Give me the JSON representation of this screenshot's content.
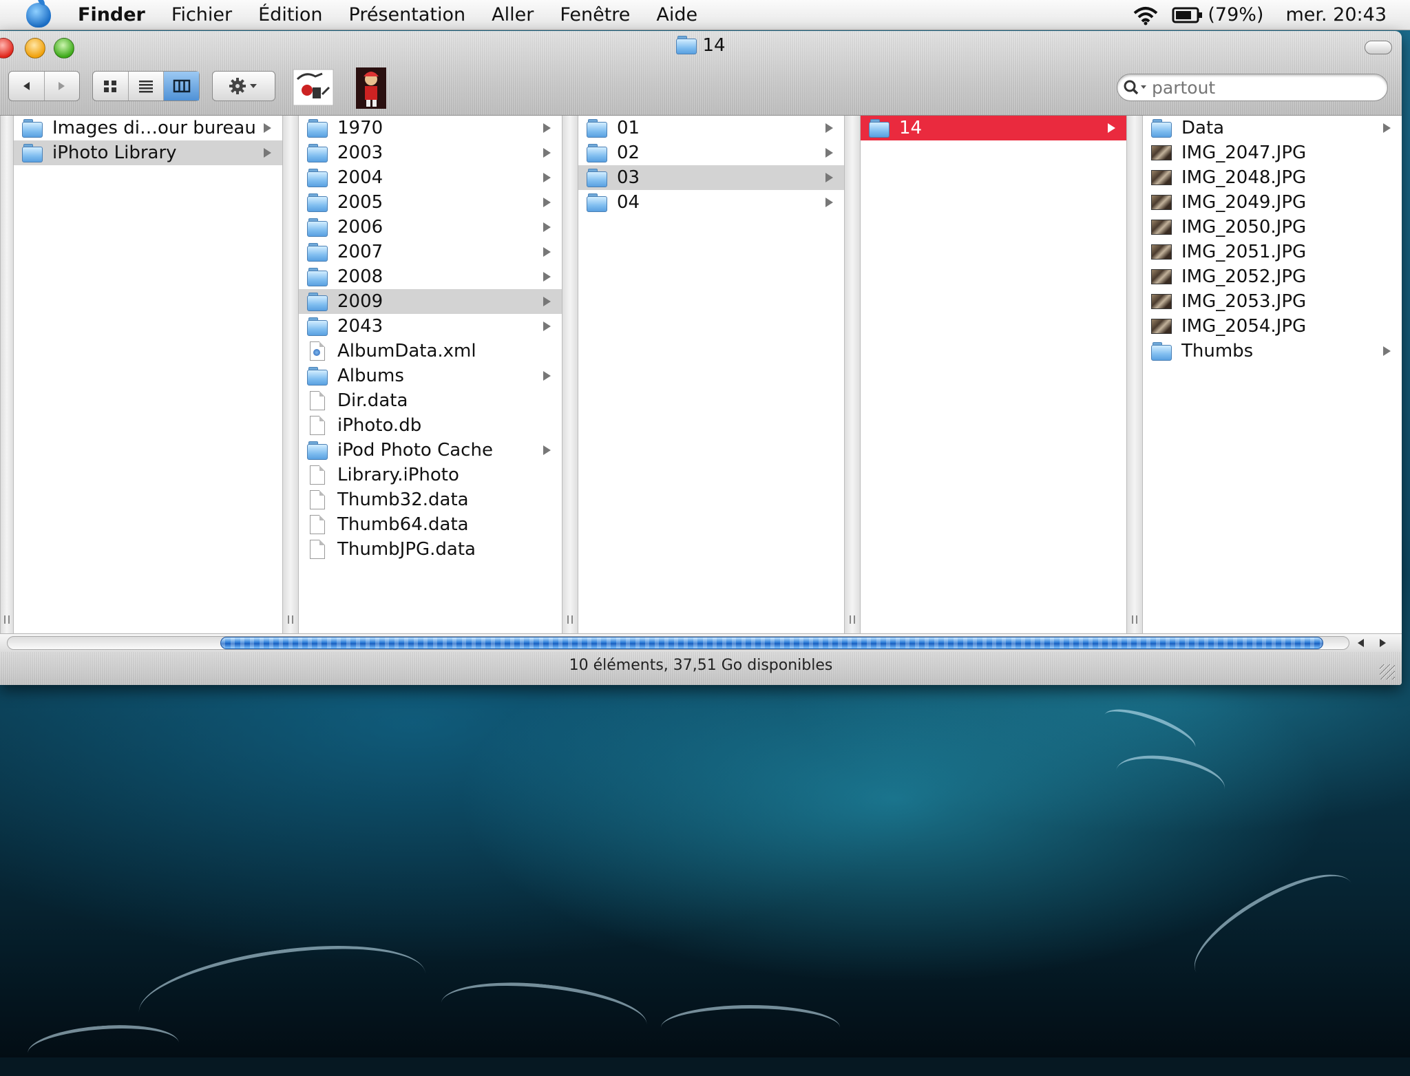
{
  "menubar": {
    "items": [
      "Finder",
      "Fichier",
      "Édition",
      "Présentation",
      "Aller",
      "Fenêtre",
      "Aide"
    ],
    "battery": "(79%)",
    "clock": "mer. 20:43"
  },
  "window": {
    "title": "14",
    "search_placeholder": "partout",
    "status": "10 éléments, 37,51 Go disponibles"
  },
  "columns": [
    [
      {
        "label": "Images di…our bureau",
        "icon": "folder-icon",
        "arrow": true
      },
      {
        "label": "iPhoto Library",
        "icon": "folder-icon",
        "arrow": true,
        "selected": "gray"
      }
    ],
    [
      {
        "label": "1970",
        "icon": "folder-icon",
        "arrow": true
      },
      {
        "label": "2003",
        "icon": "folder-icon",
        "arrow": true
      },
      {
        "label": "2004",
        "icon": "folder-icon",
        "arrow": true
      },
      {
        "label": "2005",
        "icon": "folder-icon",
        "arrow": true
      },
      {
        "label": "2006",
        "icon": "folder-icon",
        "arrow": true
      },
      {
        "label": "2007",
        "icon": "folder-icon",
        "arrow": true
      },
      {
        "label": "2008",
        "icon": "folder-icon",
        "arrow": true
      },
      {
        "label": "2009",
        "icon": "folder-icon",
        "arrow": true,
        "selected": "gray"
      },
      {
        "label": "2043",
        "icon": "folder-icon",
        "arrow": true
      },
      {
        "label": "AlbumData.xml",
        "icon": "xml-document-icon",
        "arrow": false
      },
      {
        "label": "Albums",
        "icon": "folder-icon",
        "arrow": true
      },
      {
        "label": "Dir.data",
        "icon": "document-icon",
        "arrow": false
      },
      {
        "label": "iPhoto.db",
        "icon": "document-icon",
        "arrow": false
      },
      {
        "label": "iPod Photo Cache",
        "icon": "folder-icon",
        "arrow": true
      },
      {
        "label": "Library.iPhoto",
        "icon": "document-icon",
        "arrow": false
      },
      {
        "label": "Thumb32.data",
        "icon": "document-icon",
        "arrow": false
      },
      {
        "label": "Thumb64.data",
        "icon": "document-icon",
        "arrow": false
      },
      {
        "label": "ThumbJPG.data",
        "icon": "document-icon",
        "arrow": false
      }
    ],
    [
      {
        "label": "01",
        "icon": "folder-icon",
        "arrow": true
      },
      {
        "label": "02",
        "icon": "folder-icon",
        "arrow": true
      },
      {
        "label": "03",
        "icon": "folder-icon",
        "arrow": true,
        "selected": "gray"
      },
      {
        "label": "04",
        "icon": "folder-icon",
        "arrow": true
      }
    ],
    [
      {
        "label": "14",
        "icon": "folder-icon",
        "arrow": true,
        "selected": "red"
      }
    ],
    [
      {
        "label": "Data",
        "icon": "folder-icon",
        "arrow": true
      },
      {
        "label": "IMG_2047.JPG",
        "icon": "photo-thumbnail-icon",
        "arrow": false
      },
      {
        "label": "IMG_2048.JPG",
        "icon": "photo-thumbnail-icon",
        "arrow": false
      },
      {
        "label": "IMG_2049.JPG",
        "icon": "photo-thumbnail-icon",
        "arrow": false
      },
      {
        "label": "IMG_2050.JPG",
        "icon": "photo-thumbnail-icon",
        "arrow": false
      },
      {
        "label": "IMG_2051.JPG",
        "icon": "photo-thumbnail-icon",
        "arrow": false
      },
      {
        "label": "IMG_2052.JPG",
        "icon": "photo-thumbnail-icon",
        "arrow": false
      },
      {
        "label": "IMG_2053.JPG",
        "icon": "photo-thumbnail-icon",
        "arrow": false
      },
      {
        "label": "IMG_2054.JPG",
        "icon": "photo-thumbnail-icon",
        "arrow": false
      },
      {
        "label": "Thumbs",
        "icon": "folder-icon",
        "arrow": true
      }
    ]
  ],
  "colors": {
    "selection_red": "#ea2a3e",
    "selection_gray": "#d3d3d3",
    "scroll_blue": "#2f7fd9"
  }
}
